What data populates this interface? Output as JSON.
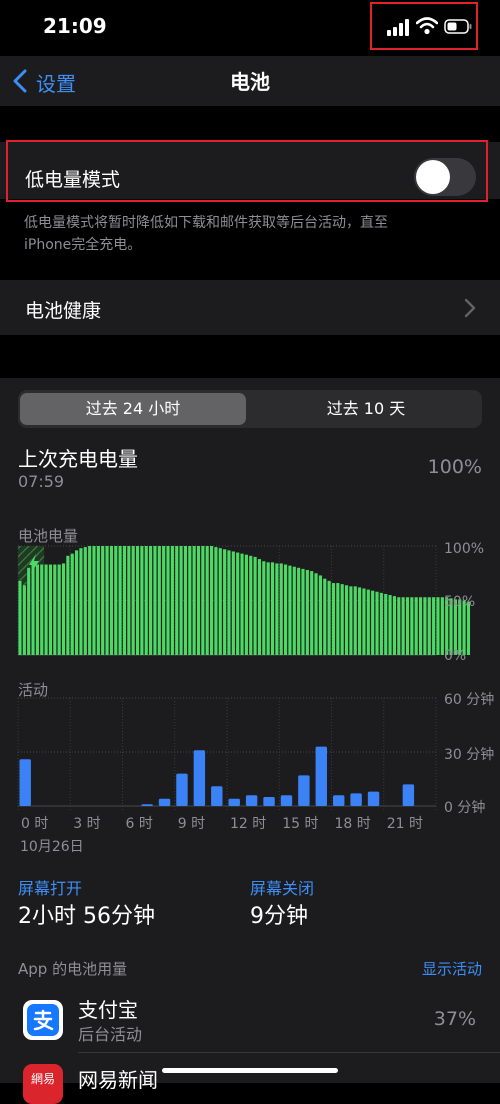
{
  "status_bar": {
    "time": "21:09",
    "battery_level": 0.5
  },
  "nav": {
    "back_label": "设置",
    "title": "电池"
  },
  "low_power": {
    "label": "低电量模式",
    "enabled": false,
    "description_line1": "低电量模式将暂时降低如下载和邮件获取等后台活动，直至",
    "description_line2": "iPhone完全充电。"
  },
  "battery_health": {
    "label": "电池健康"
  },
  "segment": {
    "tabs": [
      "过去 24 小时",
      "过去 10 天"
    ],
    "selected": 0
  },
  "last_charge": {
    "label": "上次充电电量",
    "time": "07:59",
    "value": "100%"
  },
  "level_chart": {
    "title": "电池电量",
    "y_ticks": [
      "100%",
      "50%",
      "0%"
    ]
  },
  "activity_chart": {
    "title": "活动",
    "y_ticks": [
      "60 分钟",
      "30 分钟",
      "0 分钟"
    ],
    "x_ticks": [
      "0 时",
      "3 时",
      "6 时",
      "9 时",
      "12 时",
      "15 时",
      "18 时",
      "21 时"
    ],
    "date": "10月26日"
  },
  "chart_data": [
    {
      "type": "bar",
      "title": "电池电量",
      "unit": "%",
      "ylim": [
        0,
        100
      ],
      "charging_hours": [
        0,
        1.5
      ],
      "values": [
        68,
        64,
        80,
        83,
        83,
        83,
        83,
        83,
        83,
        83,
        84,
        91,
        93,
        96,
        98,
        99,
        100,
        100,
        100,
        100,
        100,
        100,
        100,
        100,
        100,
        100,
        100,
        100,
        100,
        100,
        100,
        100,
        100,
        100,
        100,
        100,
        100,
        100,
        100,
        100,
        100,
        100,
        100,
        100,
        100,
        99,
        98,
        97,
        96,
        95,
        94,
        93,
        92,
        91,
        90,
        88,
        86,
        85,
        85,
        84,
        84,
        83,
        82,
        81,
        80,
        79,
        78,
        77,
        75,
        73,
        70,
        68,
        66,
        66,
        65,
        64,
        63,
        63,
        62,
        61,
        60,
        59,
        58,
        57,
        56,
        55,
        54,
        53,
        53,
        53,
        53,
        53,
        53,
        53,
        53,
        53,
        53,
        53,
        53,
        52,
        51,
        51,
        50,
        49
      ]
    },
    {
      "type": "bar",
      "title": "活动",
      "unit": "分钟",
      "ylim": [
        0,
        60
      ],
      "categories": [
        "0",
        "1",
        "2",
        "3",
        "4",
        "5",
        "6",
        "7",
        "8",
        "9",
        "10",
        "11",
        "12",
        "13",
        "14",
        "15",
        "16",
        "17",
        "18",
        "19",
        "20",
        "21",
        "22",
        "23"
      ],
      "values": [
        26,
        0,
        0,
        0,
        0,
        0,
        0,
        1,
        4,
        18,
        31,
        11,
        4,
        6,
        5,
        6,
        17,
        33,
        6,
        7,
        8,
        0,
        12,
        0
      ]
    }
  ],
  "screen": {
    "on_label": "屏幕打开",
    "on_value": "2小时 56分钟",
    "off_label": "屏幕关闭",
    "off_value": "9分钟"
  },
  "app_usage": {
    "title": "App 的电池用量",
    "action": "显示活动",
    "apps": [
      {
        "name": "支付宝",
        "subtitle": "后台活动",
        "percent": "37%",
        "icon": "alipay-icon",
        "color": "#1677ff"
      },
      {
        "name": "网易新闻",
        "icon": "netease-news-icon",
        "color": "#d9252b",
        "icon_text": "網易"
      }
    ]
  },
  "colors": {
    "green": "#4cd964",
    "blue": "#3b82f6",
    "accent": "#3e8ef7"
  }
}
